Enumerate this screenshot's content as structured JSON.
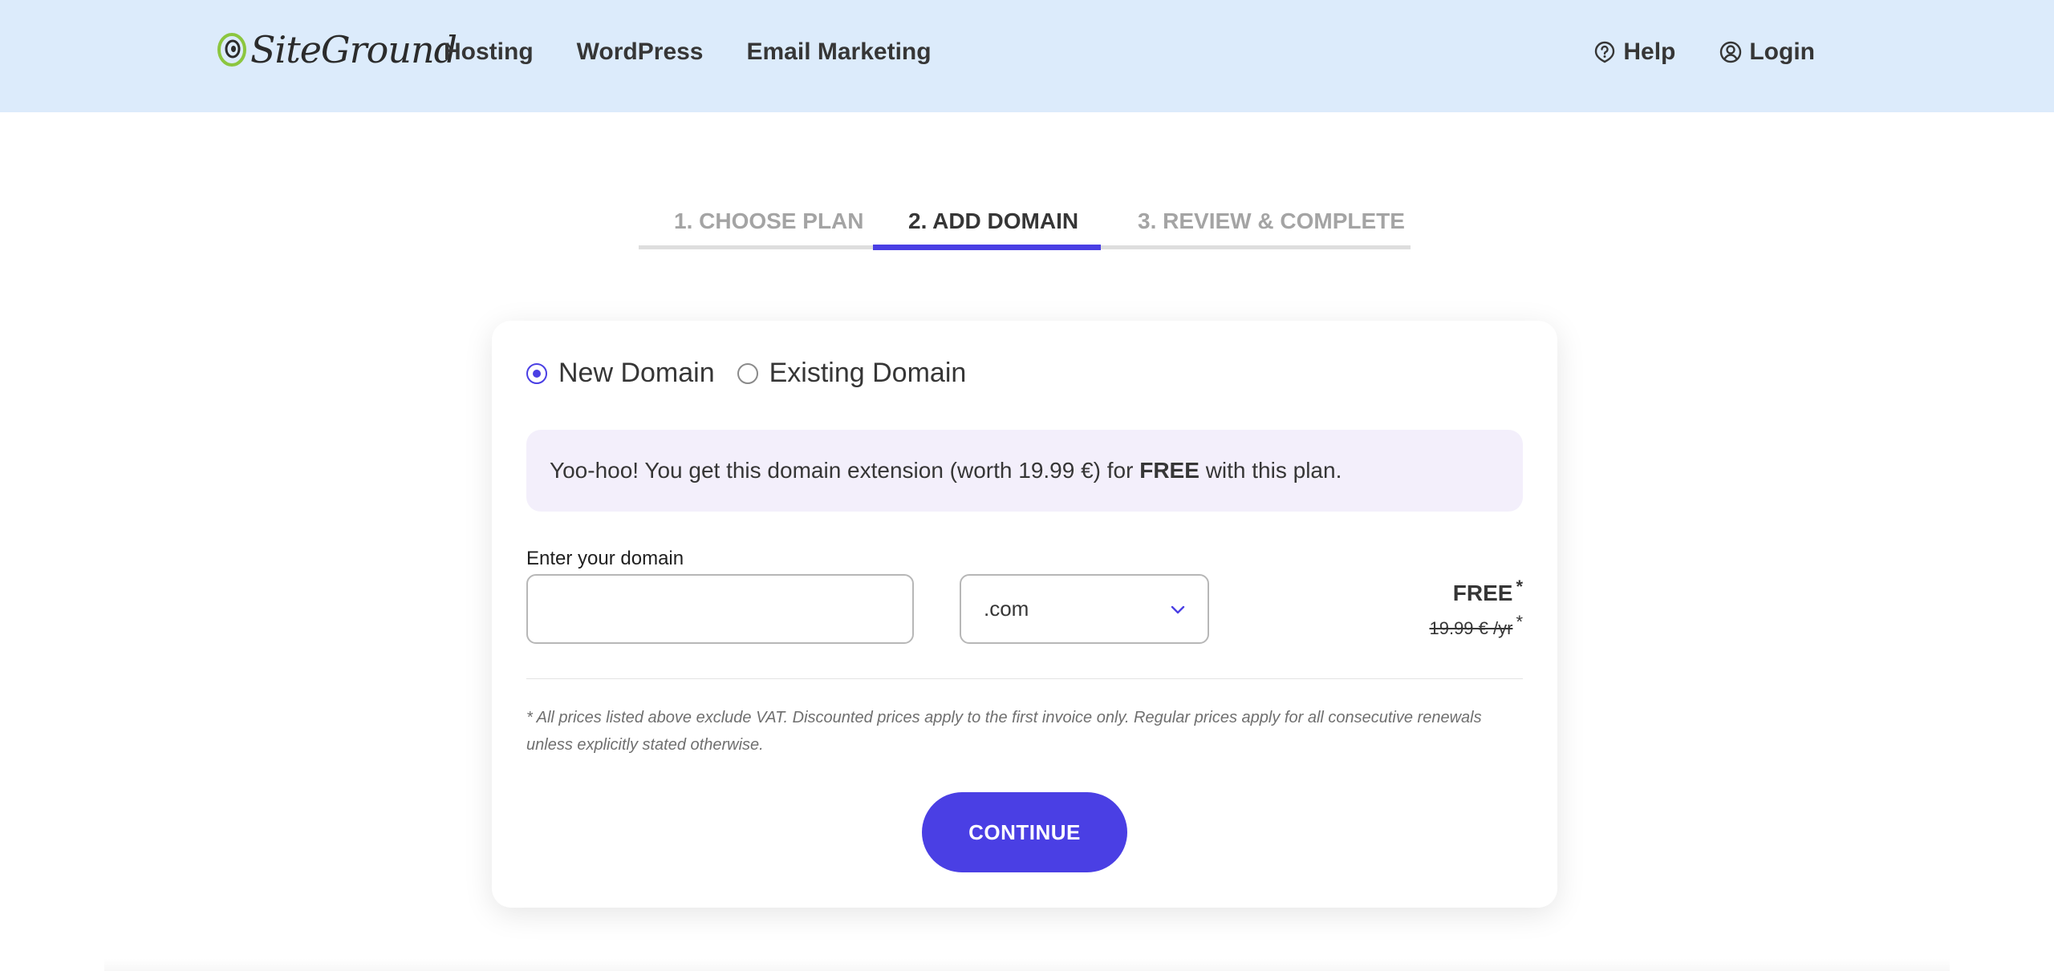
{
  "header": {
    "logo_text": "SiteGround",
    "nav": [
      {
        "label": "Hosting"
      },
      {
        "label": "WordPress"
      },
      {
        "label": "Email Marketing"
      }
    ],
    "help_label": "Help",
    "login_label": "Login",
    "colors": {
      "background": "#dcebfb",
      "logo_green": "#8cc63f"
    }
  },
  "steps": {
    "items": [
      {
        "label": "1. CHOOSE PLAN",
        "state": "done"
      },
      {
        "label": "2. ADD DOMAIN",
        "state": "active"
      },
      {
        "label": "3. REVIEW & COMPLETE",
        "state": "upcoming"
      }
    ],
    "accent": "#4a3fe4"
  },
  "domain_form": {
    "options": [
      {
        "label": "New Domain",
        "checked": true
      },
      {
        "label": "Existing Domain",
        "checked": false
      }
    ],
    "promo": {
      "text_before": "Yoo-hoo! You get this domain extension (worth 19.99 €) for ",
      "bold": "FREE",
      "text_after": " with this plan."
    },
    "input_label": "Enter your domain",
    "input_value": "",
    "input_placeholder": "",
    "tld_selected": ".com",
    "price_now": "FREE",
    "price_now_star": "*",
    "price_regular": "19.99 € /yr",
    "price_regular_star": "*",
    "disclaimer": "* All prices listed above exclude VAT. Discounted prices apply to the first invoice only. Regular prices apply for all consecutive renewals unless explicitly stated otherwise.",
    "continue_label": "CONTINUE"
  }
}
